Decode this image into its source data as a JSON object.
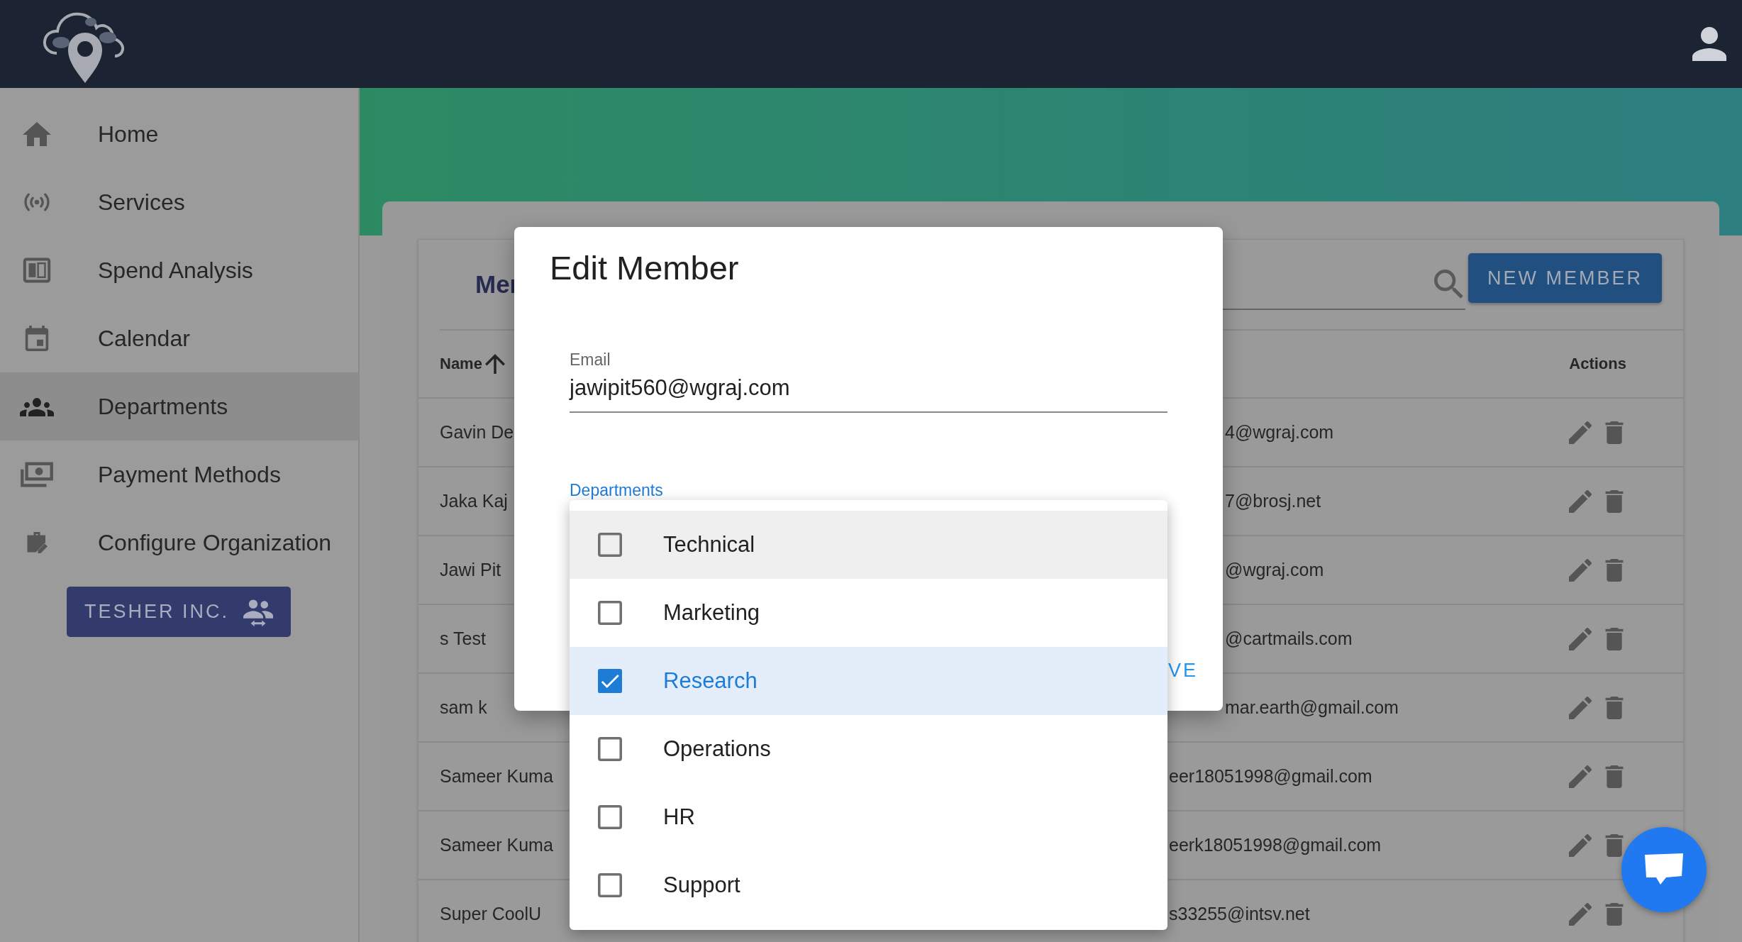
{
  "sidebar": {
    "items": [
      {
        "label": "Home",
        "selected": false
      },
      {
        "label": "Services",
        "selected": false
      },
      {
        "label": "Spend Analysis",
        "selected": false
      },
      {
        "label": "Calendar",
        "selected": false
      },
      {
        "label": "Departments",
        "selected": true
      },
      {
        "label": "Payment Methods",
        "selected": false
      },
      {
        "label": "Configure Organization",
        "selected": false
      }
    ],
    "organization_button": "TESHER INC."
  },
  "members_card": {
    "title": "Mer",
    "new_member_button": "NEW MEMBER",
    "table": {
      "columns": [
        "Name",
        "Actions"
      ],
      "rows": [
        {
          "name": "Gavin De",
          "email": "4@wgraj.com"
        },
        {
          "name": "Jaka Kaj",
          "email": "7@brosj.net"
        },
        {
          "name": "Jawi Pit",
          "email": "@wgraj.com"
        },
        {
          "name": "s Test",
          "email": "@cartmails.com"
        },
        {
          "name": "sam k",
          "email": "mar.earth@gmail.com"
        },
        {
          "name": "Sameer Kuma",
          "email": "eer18051998@gmail.com"
        },
        {
          "name": "Sameer Kuma",
          "email": "eerk18051998@gmail.com"
        },
        {
          "name": "Super CoolU",
          "email": "s33255@intsv.net"
        }
      ]
    }
  },
  "dialog": {
    "title": "Edit Member",
    "email": {
      "label": "Email",
      "value": "jawipit560@wgraj.com"
    },
    "departments": {
      "label": "Departments",
      "options": [
        {
          "label": "Technical",
          "checked": false,
          "highlighted": true
        },
        {
          "label": "Marketing",
          "checked": false,
          "highlighted": false
        },
        {
          "label": "Research",
          "checked": true,
          "highlighted": false
        },
        {
          "label": "Operations",
          "checked": false,
          "highlighted": false
        },
        {
          "label": "HR",
          "checked": false,
          "highlighted": false
        },
        {
          "label": "Support",
          "checked": false,
          "highlighted": false
        }
      ]
    },
    "save_button": "VE"
  }
}
